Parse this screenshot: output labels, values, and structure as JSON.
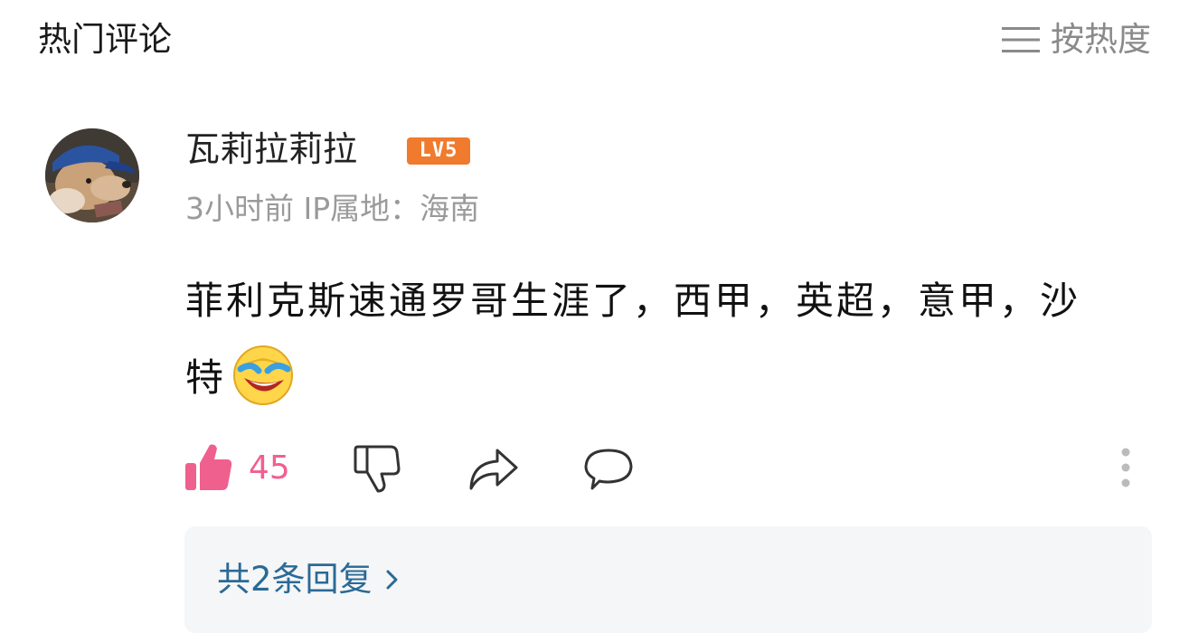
{
  "header": {
    "title": "热门评论",
    "sort_label": "按热度",
    "sort_icon": "menu-lines-icon"
  },
  "comment": {
    "username": "瓦莉拉莉拉",
    "level_badge": "LV5",
    "badge_color": "#f07b2c",
    "meta": "3小时前 IP属地：海南",
    "text": "菲利克斯速通罗哥生涯了，西甲，英超，意甲，沙特",
    "emoji": "laughing-tears-emoji",
    "like_count": "45",
    "like_color": "#f0608f"
  },
  "replies": {
    "label": "共2条回复",
    "link_color": "#2a6a95"
  }
}
